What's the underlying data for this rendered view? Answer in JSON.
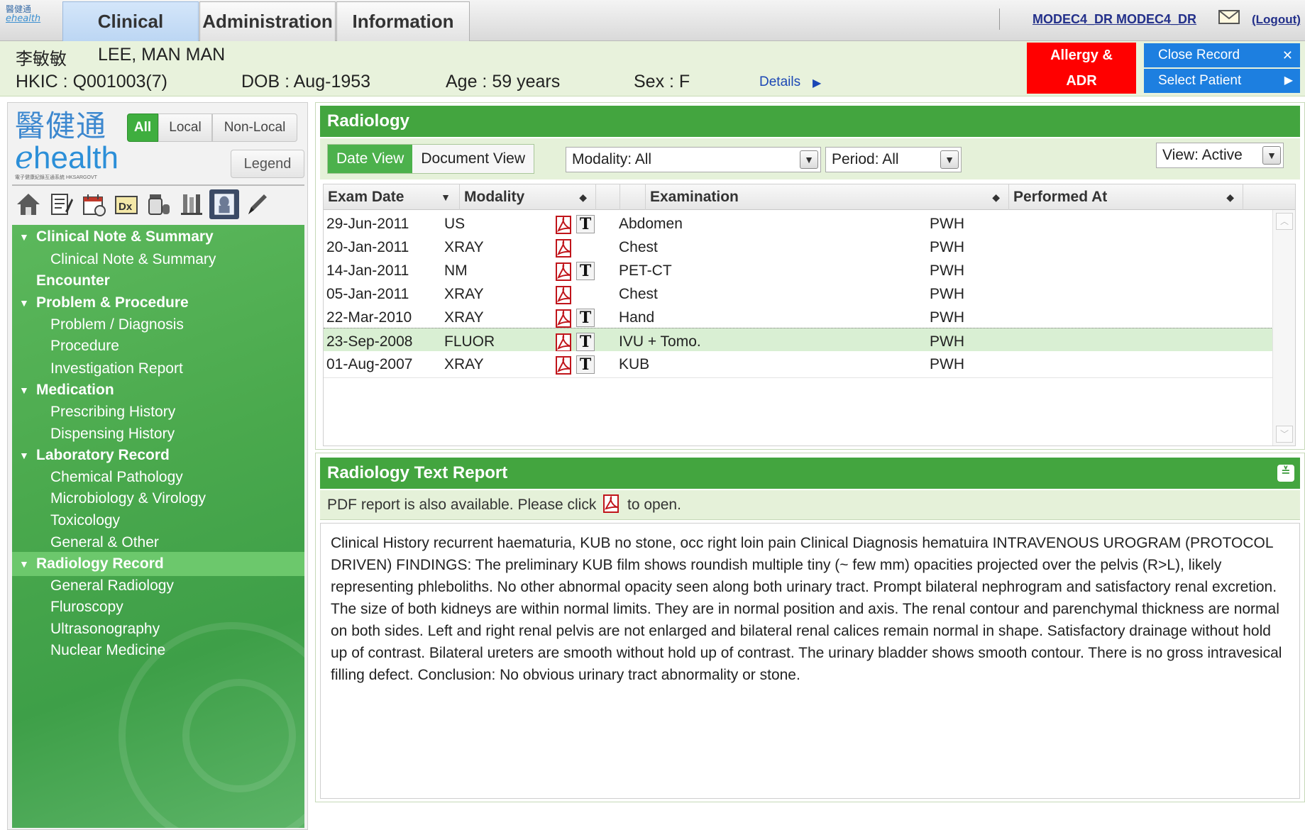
{
  "topbar": {
    "logo_cn": "醫健通",
    "logo_en": "ehealth",
    "tabs": [
      {
        "label": "Clinical",
        "active": true
      },
      {
        "label": "Administration",
        "active": false
      },
      {
        "label": "Information",
        "active": false
      }
    ],
    "user": "MODEC4_DR MODEC4_DR",
    "logout": "(Logout)"
  },
  "patient": {
    "chinese_name": "李敏敏",
    "name": "LEE, MAN MAN",
    "hkic": "HKIC : Q001003(7)",
    "dob": "DOB : Aug-1953",
    "age": "Age : 59 years",
    "sex": "Sex : F",
    "details_link": "Details",
    "allergy_line1": "Allergy &",
    "allergy_line2": "ADR",
    "close_record": "Close Record",
    "select_patient": "Select Patient"
  },
  "left": {
    "logo_cn": "醫健通",
    "logo_en_e": "e",
    "logo_en_rest": "health",
    "logo_tagline": "電子健康紀錄互通系統 HKSARGOVT",
    "scope": {
      "all": "All",
      "local": "Local",
      "nonlocal": "Non-Local"
    },
    "legend": "Legend",
    "toolbar_icons": [
      "home-icon",
      "notes-icon",
      "calendar-icon",
      "diagnosis-icon",
      "medication-icon",
      "lab-icon",
      "radiology-icon",
      "pen-icon"
    ],
    "nav": [
      {
        "label": "Clinical Note & Summary",
        "type": "section",
        "caret": true
      },
      {
        "label": "Clinical Note & Summary",
        "type": "child"
      },
      {
        "label": "Encounter",
        "type": "section",
        "caret": false
      },
      {
        "label": "Problem & Procedure",
        "type": "section",
        "caret": true
      },
      {
        "label": "Problem / Diagnosis",
        "type": "child"
      },
      {
        "label": "Procedure",
        "type": "child"
      },
      {
        "label": "Investigation Report",
        "type": "child"
      },
      {
        "label": "Medication",
        "type": "section",
        "caret": true
      },
      {
        "label": "Prescribing History",
        "type": "child"
      },
      {
        "label": "Dispensing History",
        "type": "child"
      },
      {
        "label": "Laboratory Record",
        "type": "section",
        "caret": true
      },
      {
        "label": "Chemical Pathology",
        "type": "child"
      },
      {
        "label": "Microbiology & Virology",
        "type": "child"
      },
      {
        "label": "Toxicology",
        "type": "child"
      },
      {
        "label": "General & Other",
        "type": "child"
      },
      {
        "label": "Radiology Record",
        "type": "section",
        "caret": true,
        "selected": true
      },
      {
        "label": "General Radiology",
        "type": "child"
      },
      {
        "label": "Fluroscopy",
        "type": "child"
      },
      {
        "label": "Ultrasonography",
        "type": "child"
      },
      {
        "label": "Nuclear Medicine",
        "type": "child"
      }
    ]
  },
  "radiology": {
    "title": "Radiology",
    "date_view": "Date View",
    "document_view": "Document View",
    "modality_filter": "Modality: All",
    "period_filter": "Period: All",
    "view_filter": "View: Active",
    "columns": {
      "exam_date": "Exam Date",
      "modality": "Modality",
      "examination": "Examination",
      "performed_at": "Performed At"
    },
    "rows": [
      {
        "date": "29-Jun-2011",
        "modality": "US",
        "exam": "Abdomen",
        "at": "PWH",
        "pdf": true,
        "text": true,
        "selected": false
      },
      {
        "date": "20-Jan-2011",
        "modality": "XRAY",
        "exam": "Chest",
        "at": "PWH",
        "pdf": true,
        "text": false,
        "selected": false
      },
      {
        "date": "14-Jan-2011",
        "modality": "NM",
        "exam": "PET-CT",
        "at": "PWH",
        "pdf": true,
        "text": true,
        "selected": false
      },
      {
        "date": "05-Jan-2011",
        "modality": "XRAY",
        "exam": "Chest",
        "at": "PWH",
        "pdf": true,
        "text": false,
        "selected": false
      },
      {
        "date": "22-Mar-2010",
        "modality": "XRAY",
        "exam": "Hand",
        "at": "PWH",
        "pdf": true,
        "text": true,
        "selected": false
      },
      {
        "date": "23-Sep-2008",
        "modality": "FLUOR",
        "exam": "IVU + Tomo.",
        "at": "PWH",
        "pdf": true,
        "text": true,
        "selected": true
      },
      {
        "date": "01-Aug-2007",
        "modality": "XRAY",
        "exam": "KUB",
        "at": "PWH",
        "pdf": true,
        "text": true,
        "selected": false
      }
    ]
  },
  "report": {
    "title": "Radiology Text Report",
    "pdf_note_before": "PDF report is also available. Please click",
    "pdf_note_after": "to open.",
    "body": "Clinical History recurrent haematuria, KUB no stone, occ right loin pain Clinical Diagnosis hematuira INTRAVENOUS UROGRAM (PROTOCOL DRIVEN) FINDINGS: The preliminary KUB film shows roundish multiple tiny (~ few mm) opacities projected over the pelvis (R>L), likely representing phleboliths. No other abnormal opacity seen along both urinary tract. Prompt bilateral nephrogram and satisfactory renal excretion. The size of both kidneys are within normal limits. They are in normal position and axis. The renal contour and parenchymal thickness are normal on both sides. Left and right renal pelvis are not enlarged and bilateral renal calices remain normal in shape. Satisfactory drainage without hold up of contrast. Bilateral ureters are smooth without hold up of contrast. The urinary bladder shows smooth contour. There is no gross intravesical filling defect. Conclusion: No obvious urinary tract abnormality or stone."
  },
  "colors": {
    "header_green": "#43a53f",
    "nav_green": "#4aa94d",
    "allergy_red": "#ff0000",
    "action_blue": "#1d7fe0",
    "selected_row": "#d9efd3"
  }
}
